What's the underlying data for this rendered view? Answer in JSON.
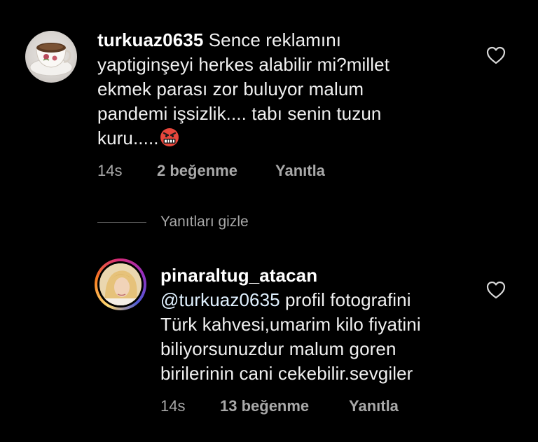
{
  "comments": [
    {
      "username": "turkuaz0635",
      "lines": [
        "Sence reklamını",
        "yaptiginşeyi herkes alabilir mi?millet",
        "ekmek parası zor buluyor malum",
        "pandemi işsizlik.... tabı senin tuzun",
        "kuru....."
      ],
      "emoji_icon": "angry-cursing-face-icon",
      "time": "14s",
      "likes": "2 beğenme",
      "reply_label": "Yanıtla"
    },
    {
      "username": "pinaraltug_atacan",
      "mention": "@turkuaz0635",
      "lines": [
        "profil fotografini",
        "Türk kahvesi,umarim kilo fiyatini",
        "biliyorsunuzdur malum goren",
        "birilerinin cani cekebilir.sevgiler"
      ],
      "time": "14s",
      "likes": "13 beğenme",
      "reply_label": "Yanıtla"
    }
  ],
  "hide_replies_label": "Yanıtları gizle",
  "colors": {
    "background": "#000000",
    "text": "#f0f0f0",
    "meta": "#a8a8a8",
    "mention": "#e0f1ff"
  },
  "icons": {
    "like": "heart-outline-icon"
  }
}
